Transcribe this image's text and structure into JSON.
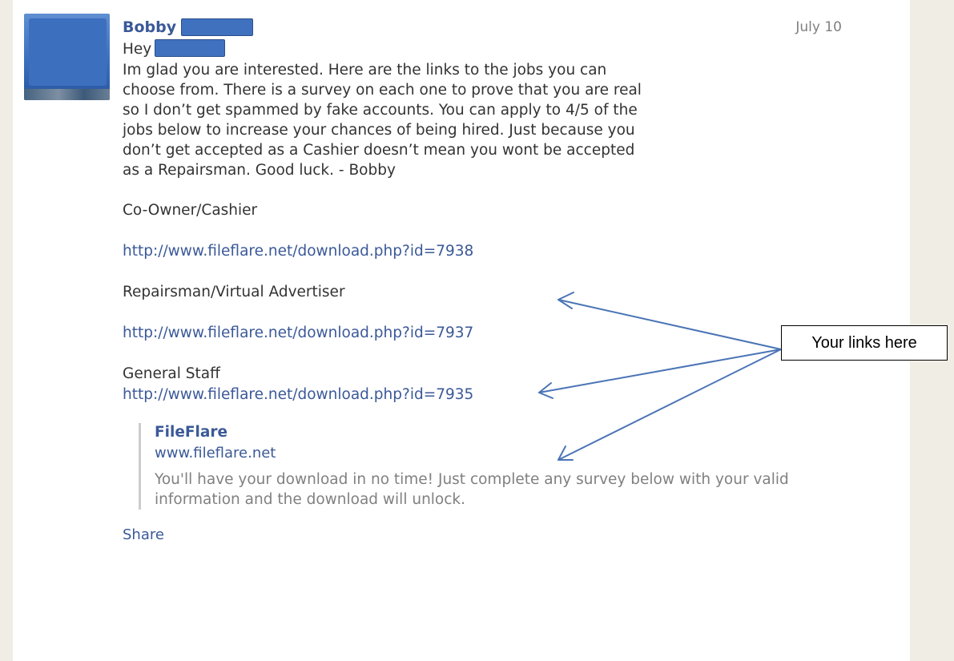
{
  "message": {
    "sender": "Bobby",
    "date": "July 10",
    "greeting": "Hey",
    "paragraph_lines": [
      "Im glad you are interested. Here are the links to the jobs you can",
      "choose from. There is a survey on each one to prove that you are real",
      "so I don’t get spammed by fake accounts. You can apply to 4/5 of the",
      "jobs below to increase your chances of being hired. Just because you",
      "don’t get accepted as a Cashier doesn’t mean you wont be accepted",
      "as a Repairsman. Good luck. - Bobby"
    ],
    "jobs": [
      {
        "title": "Co-Owner/Cashier",
        "link": "http://www.fileflare.net/download.php?id=7938"
      },
      {
        "title": "Repairsman/Virtual Advertiser",
        "link": "http://www.fileflare.net/download.php?id=7937"
      },
      {
        "title": "General Staff",
        "link": "http://www.fileflare.net/download.php?id=7935"
      }
    ]
  },
  "attachment": {
    "title": "FileFlare",
    "url": "www.fileflare.net",
    "description_lines": [
      "You'll have your download in no time! Just complete any survey below with your valid",
      "information and the download will unlock."
    ]
  },
  "share_label": "Share",
  "callout_text": "Your links here",
  "colors": {
    "link": "#3b5998",
    "redaction": "#3f71bf",
    "arrow": "#4a74b5",
    "background": "#f0ede4"
  }
}
